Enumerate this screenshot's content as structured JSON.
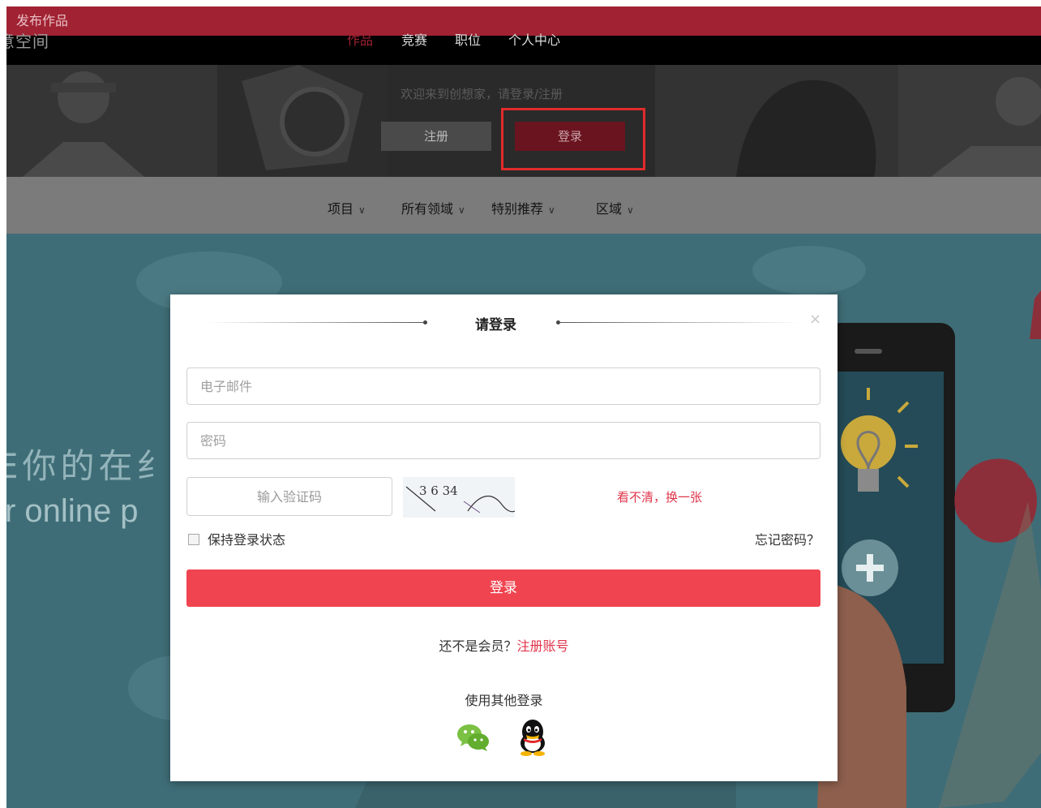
{
  "nav": {
    "logo": "意空间",
    "items": [
      "作品",
      "竞赛",
      "职位",
      "个人中心"
    ],
    "publish": "发布作品"
  },
  "banner": {
    "welcome": "欢迎来到创想家，请登录/注册",
    "register": "注册",
    "login": "登录"
  },
  "filters": [
    {
      "label": "项目"
    },
    {
      "label": "所有领域"
    },
    {
      "label": "特别推荐"
    },
    {
      "label": "区域"
    }
  ],
  "hero": {
    "cn": "E你的在纟",
    "en": "r online p"
  },
  "modal": {
    "title": "请登录",
    "close": "×",
    "email_placeholder": "电子邮件",
    "password_placeholder": "密码",
    "captcha_placeholder": "输入验证码",
    "captcha_code": "3 6 34",
    "refresh": "看不清，换一张",
    "remember": "保持登录状态",
    "forgot": "忘记密码？",
    "login_button": "登录",
    "not_member": "还不是会员？",
    "register_link": "注册账号",
    "other_login": "使用其他登录",
    "social": [
      "wechat-icon",
      "qq-icon"
    ]
  },
  "colors": {
    "accent": "#f04450",
    "link": "#e0344a",
    "highlight": "#e12b2b"
  }
}
